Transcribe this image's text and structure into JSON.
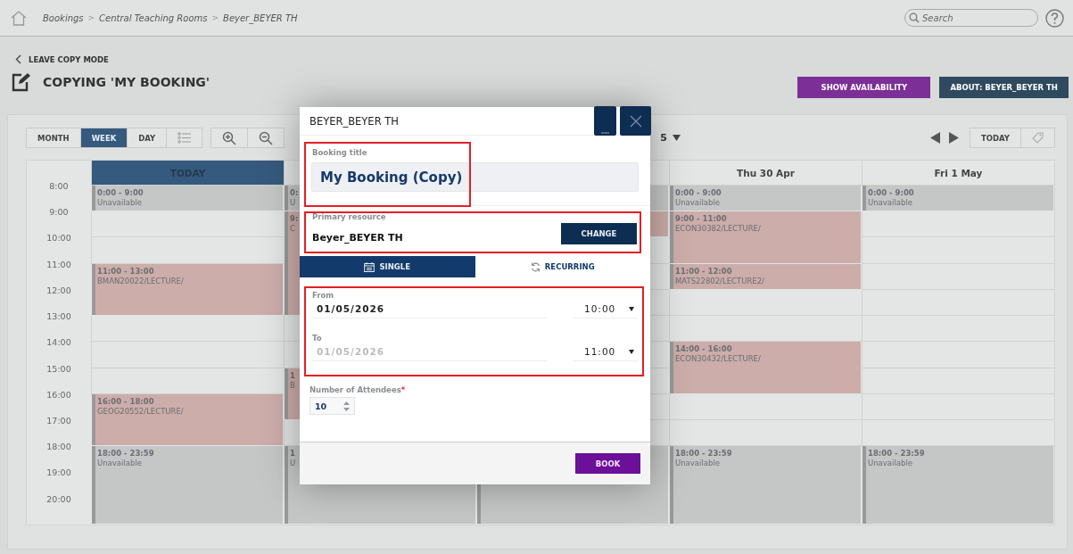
{
  "breadcrumbs": [
    {
      "label": "Bookings",
      "separator": ">"
    },
    {
      "label": "Central Teaching Rooms",
      "separator": ">"
    },
    {
      "label": "Beyer_BEYER TH"
    }
  ],
  "search": {
    "placeholder": "Search"
  },
  "back_link": "LEAVE COPY MODE",
  "page_title": "COPYING 'MY BOOKING'",
  "actions": [
    {
      "label": "SHOW AVAILABILITY",
      "kind": "primary"
    },
    {
      "label": "ABOUT: BEYER_BEYER TH",
      "kind": "secondary"
    }
  ],
  "view_modes": [
    {
      "label": "MONTH",
      "selected": false
    },
    {
      "label": "WEEK",
      "selected": true
    },
    {
      "label": "DAY",
      "selected": false
    }
  ],
  "date_range": "5",
  "nav_today": "TODAY",
  "time_labels": [
    "8:00",
    "9:00",
    "10:00",
    "11:00",
    "12:00",
    "13:00",
    "14:00",
    "15:00",
    "16:00",
    "17:00",
    "18:00",
    "19:00",
    "20:00"
  ],
  "days": [
    {
      "header": "TODAY",
      "today": true,
      "slots": [
        {
          "kind": "unavailable",
          "time": "0:00 - 9:00",
          "label": "Unavailable"
        },
        {
          "kind": "free"
        },
        {
          "kind": "free"
        },
        {
          "kind": "booking",
          "time": "11:00 - 13:00",
          "label": "BMAN20022/LECTURE/"
        },
        {
          "kind": "booking",
          "continued": true
        },
        {
          "kind": "free"
        },
        {
          "kind": "free"
        },
        {
          "kind": "free"
        },
        {
          "kind": "booking",
          "time": "16:00 - 18:00",
          "label": "GEOG20552/LECTURE/"
        },
        {
          "kind": "booking",
          "continued": true
        },
        {
          "kind": "unavailable",
          "time": "18:00 - 23:59",
          "label": "Unavailable"
        },
        {
          "kind": "unavailable",
          "continued": true
        },
        {
          "kind": "unavailable",
          "continued": true
        }
      ]
    },
    {
      "today": false,
      "slots": [
        {
          "kind": "unavailable",
          "time": "0:",
          "label": "U"
        },
        {
          "kind": "booking",
          "time": "9:",
          "label": "C"
        },
        {
          "kind": "booking",
          "continued": true
        },
        {
          "kind": "booking",
          "continued": true
        },
        {
          "kind": "booking",
          "continued": true
        },
        {
          "kind": "free"
        },
        {
          "kind": "free"
        },
        {
          "kind": "booking",
          "time": "1",
          "label": "B"
        },
        {
          "kind": "booking",
          "continued": true
        },
        {
          "kind": "free"
        },
        {
          "kind": "unavailable",
          "time": "1",
          "label": "U"
        },
        {
          "kind": "unavailable",
          "continued": true
        },
        {
          "kind": "unavailable",
          "continued": true
        }
      ]
    },
    {
      "today": false,
      "slots": [
        {
          "kind": "unavailable"
        },
        {
          "kind": "booking"
        },
        {
          "kind": "free"
        },
        {
          "kind": "free"
        },
        {
          "kind": "free"
        },
        {
          "kind": "free"
        },
        {
          "kind": "free"
        },
        {
          "kind": "free"
        },
        {
          "kind": "free"
        },
        {
          "kind": "free"
        },
        {
          "kind": "unavailable"
        },
        {
          "kind": "unavailable",
          "continued": true
        },
        {
          "kind": "unavailable",
          "continued": true
        }
      ]
    },
    {
      "header": "Thu 30 Apr",
      "today": false,
      "slots": [
        {
          "kind": "unavailable",
          "time": "0:00 - 9:00",
          "label": "Unavailable"
        },
        {
          "kind": "booking",
          "time": "9:00 - 11:00",
          "label": "ECON30382/LECTURE/"
        },
        {
          "kind": "booking",
          "continued": true
        },
        {
          "kind": "booking",
          "time": "11:00 - 12:00",
          "label": "MATS22802/LECTURE2/"
        },
        {
          "kind": "free"
        },
        {
          "kind": "free"
        },
        {
          "kind": "booking",
          "time": "14:00 - 16:00",
          "label": "ECON30432/LECTURE/"
        },
        {
          "kind": "booking",
          "continued": true
        },
        {
          "kind": "free"
        },
        {
          "kind": "free"
        },
        {
          "kind": "unavailable",
          "time": "18:00 - 23:59",
          "label": "Unavailable"
        },
        {
          "kind": "unavailable",
          "continued": true
        },
        {
          "kind": "unavailable",
          "continued": true
        }
      ]
    },
    {
      "header": "Fri 1 May",
      "today": false,
      "slots": [
        {
          "kind": "unavailable",
          "time": "0:00 - 9:00",
          "label": "Unavailable"
        },
        {
          "kind": "free"
        },
        {
          "kind": "free"
        },
        {
          "kind": "free"
        },
        {
          "kind": "free"
        },
        {
          "kind": "free"
        },
        {
          "kind": "free"
        },
        {
          "kind": "free"
        },
        {
          "kind": "free"
        },
        {
          "kind": "free"
        },
        {
          "kind": "unavailable",
          "time": "18:00 - 23:59",
          "label": "Unavailable"
        },
        {
          "kind": "unavailable",
          "continued": true
        },
        {
          "kind": "unavailable",
          "continued": true
        }
      ]
    }
  ],
  "dialog": {
    "title": "BEYER_BEYER TH",
    "booking_title": {
      "label": "Booking title",
      "value": "My Booking (Copy)"
    },
    "primary_resource": {
      "label": "Primary resource",
      "value": "Beyer_BEYER TH",
      "button": "CHANGE"
    },
    "modes": [
      {
        "label": "SINGLE",
        "kind": "single",
        "selected": true
      },
      {
        "label": "RECURRING",
        "kind": "recurring",
        "selected": false
      }
    ],
    "from": {
      "label": "From",
      "date": "01/05/2026",
      "time": "10:00",
      "disabled": false
    },
    "to": {
      "label": "To",
      "date": "01/05/2026",
      "time": "11:00",
      "disabled": true
    },
    "attendees": {
      "label": "Number of Attendees",
      "required_mark": "*",
      "value": "10"
    },
    "book_button": "BOOK"
  }
}
